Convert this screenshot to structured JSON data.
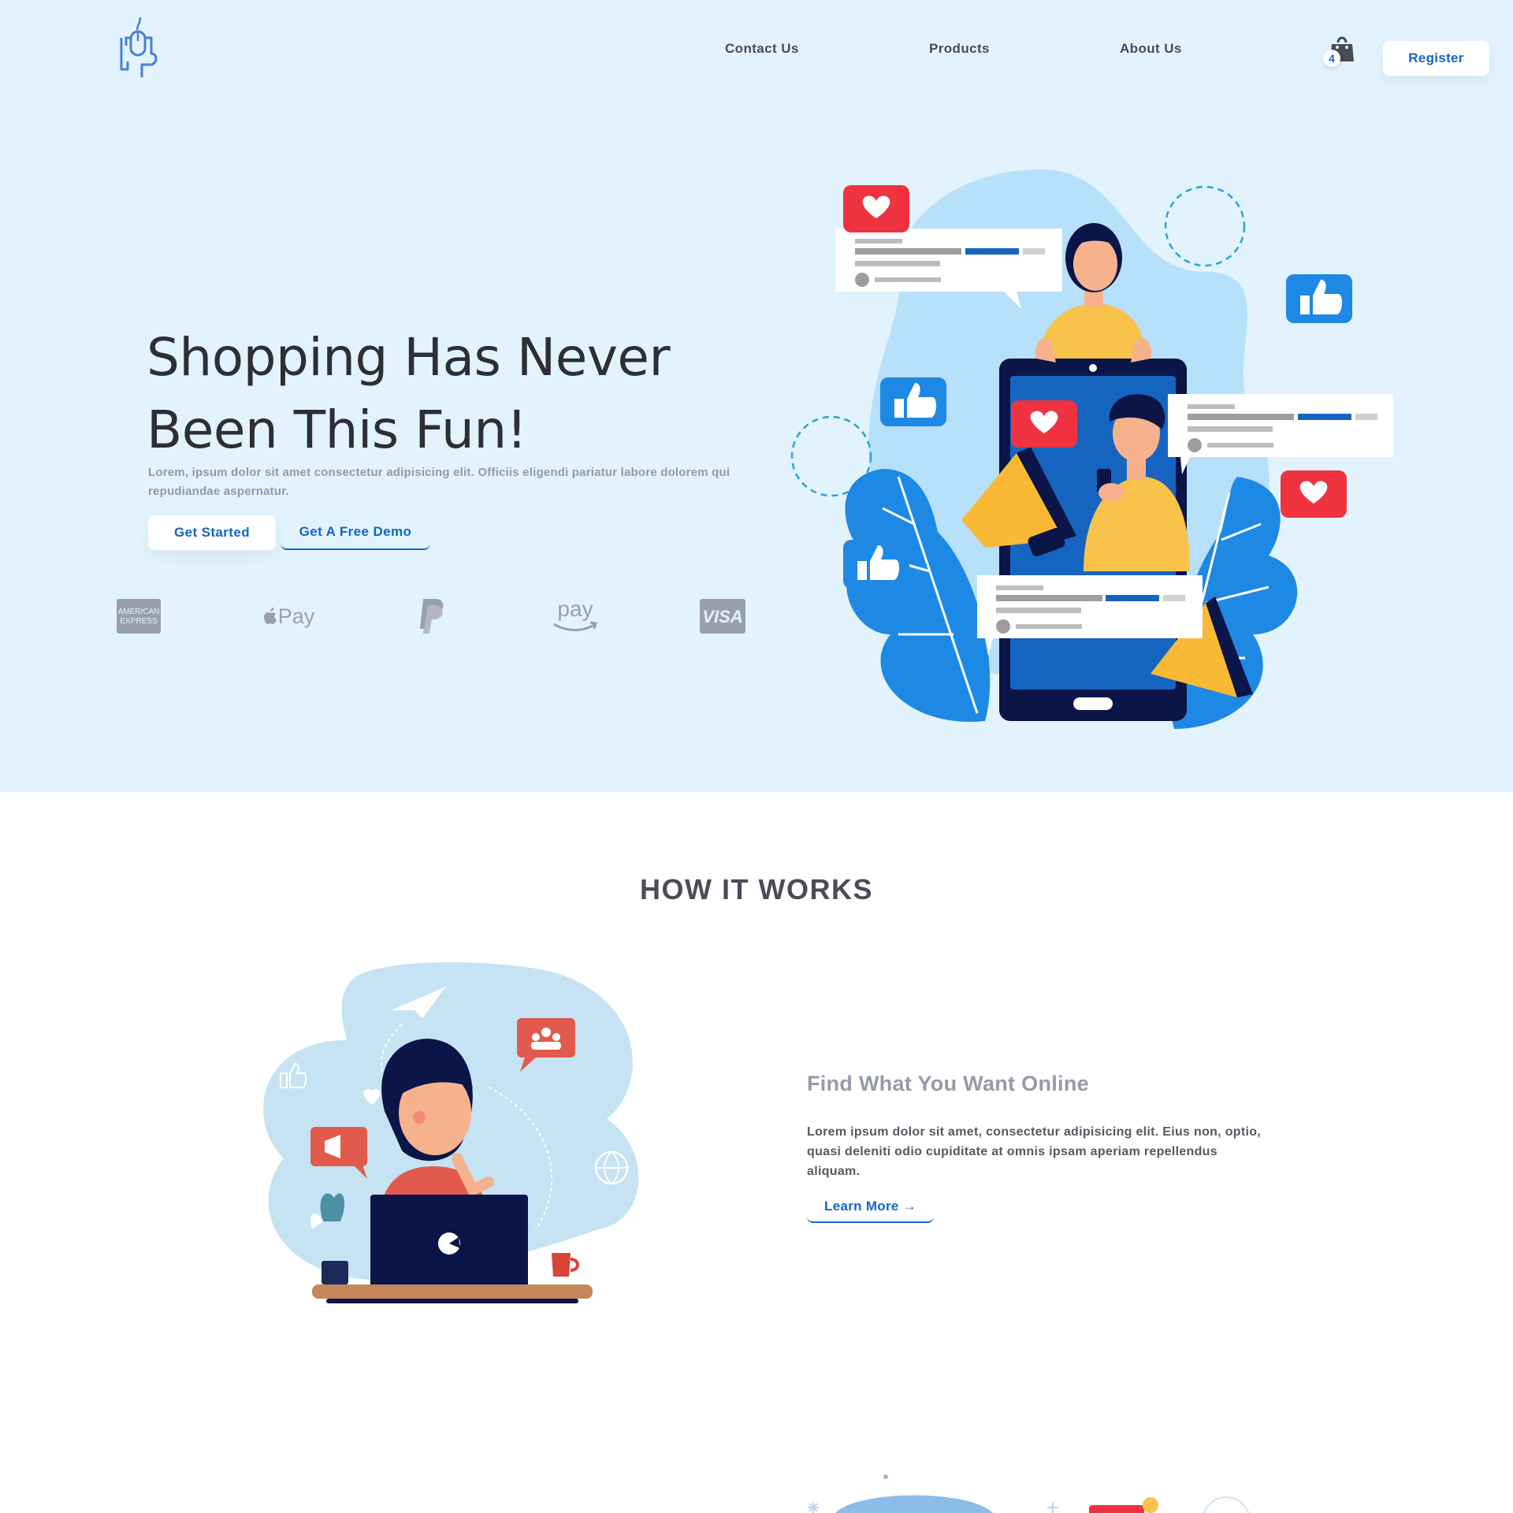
{
  "nav": {
    "links": [
      "Contact Us",
      "Products",
      "About Us"
    ],
    "cart_count": "4",
    "register_label": "Register"
  },
  "hero": {
    "title_line1": "Shopping Has Never",
    "title_line2": "Been This Fun!",
    "subtitle": "Lorem, ipsum dolor sit amet consectetur adipisicing elit. Officiis eligendi pariatur labore dolorem qui repudiandae aspernatur.",
    "primary_button": "Get Started",
    "secondary_button": "Get A Free Demo",
    "payment_logos": [
      "american-express-logo",
      "apple-pay-logo",
      "paypal-logo",
      "amazon-pay-logo",
      "visa-logo"
    ],
    "amex_text": [
      "AMERICAN",
      "EXPRESS"
    ],
    "apple_pay_text": "Pay",
    "amazon_pay_text": "pay",
    "visa_text": "VISA"
  },
  "how_it_works": {
    "title": "HOW IT WORKS",
    "feature": {
      "title": "Find What You Want Online",
      "text": "Lorem ipsum dolor sit amet, consectetur adipisicing elit. Eius non, optio, quasi deleniti odio cupiditate at omnis ipsam aperiam repellendus aliquam.",
      "link_label": "Learn More →"
    }
  },
  "colors": {
    "hero_bg": "#e2f3fd",
    "accent": "#1565c0",
    "heart_red": "#ef3340",
    "like_blue": "#1e88e5",
    "phone_navy": "#0b1548"
  }
}
